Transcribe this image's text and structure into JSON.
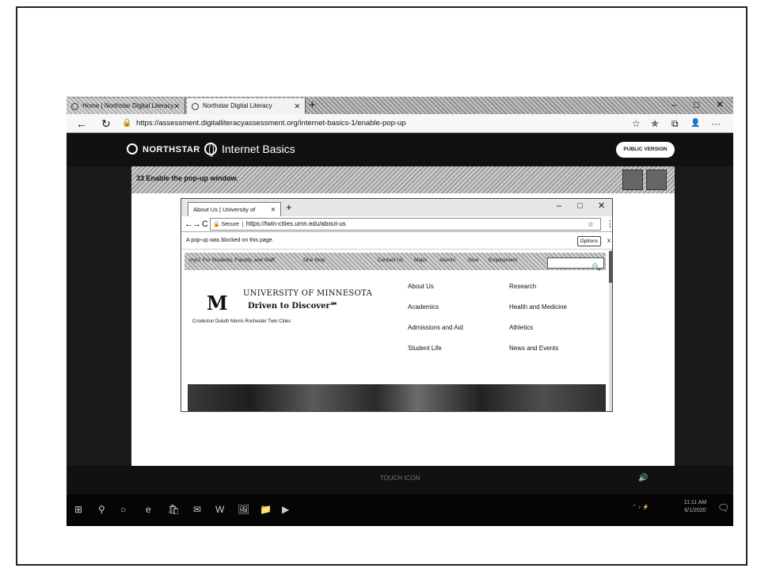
{
  "browser": {
    "tabs": [
      {
        "label": "Home | Northstar Digital Literacy",
        "close": "✕"
      },
      {
        "label": "Northstar Digital Literacy",
        "close": "✕"
      }
    ],
    "new_tab": "+",
    "window_controls": {
      "minimize": "–",
      "maximize": "□",
      "close": "✕"
    },
    "nav": {
      "back": "←",
      "refresh": "↻",
      "lock": "🔒"
    },
    "url": "https://assessment.digitalliteracyassessment.org/internet-basics-1/enable-pop-up",
    "toolbar_icons": {
      "star": "☆",
      "favorites": "✯",
      "collections": "⧉",
      "profile": "👤",
      "more": "···"
    }
  },
  "site": {
    "brand": "NORTHSTAR",
    "subtitle": "Internet Basics",
    "public_version": "PUBLIC VERSION",
    "question": "33 Enable the pop-up window."
  },
  "inner_browser": {
    "tab_label": "About Us | University of",
    "tab_close": "✕",
    "new_tab": "+",
    "window_controls": {
      "minimize": "–",
      "maximize": "□",
      "close": "✕"
    },
    "nav": {
      "back": "←",
      "forward": "→",
      "refresh": "C"
    },
    "secure": "🔒 Secure",
    "url": "https://twin-cities.umn.edu/about-us",
    "star": "☆",
    "menu": "⋮",
    "popup_notice": "A pop-up was blocked on this page.",
    "options": "Options",
    "notice_close": "x"
  },
  "umn": {
    "top_links": [
      "myU: For Students, Faculty, and Staff",
      "One Stop",
      "Contact Us",
      "Maps",
      "Alumni",
      "Give",
      "Employment"
    ],
    "search_icon": "🔍",
    "logo_mark": "M",
    "name": "UNIVERSITY OF MINNESOTA",
    "tagline": "Driven to Discover℠",
    "campuses": "Crookston  Duluth  Morris  Rochester  Twin Cities",
    "nav": [
      "About Us",
      "Research",
      "Academics",
      "Health and Medicine",
      "Admissions and Aid",
      "Athletics",
      "Student Life",
      "News and Events"
    ]
  },
  "footer": {
    "text": "TOUCH ICON",
    "volume": "🔊"
  },
  "taskbar": {
    "icons": {
      "start": "⊞",
      "search": "⚲",
      "cortana": "○",
      "edge": "e",
      "store": "🛍",
      "mail": "✉",
      "word": "W",
      "photos": "🖼",
      "explorer": "📁",
      "media": "▶"
    },
    "tray": "⌃ ♪ ⚡",
    "time": "11:11 AM",
    "date": "6/1/2020",
    "notifications": "🗨"
  },
  "colors": {
    "header_bg": "#111111",
    "page_bg": "#ffffff",
    "accent": "#777777"
  }
}
